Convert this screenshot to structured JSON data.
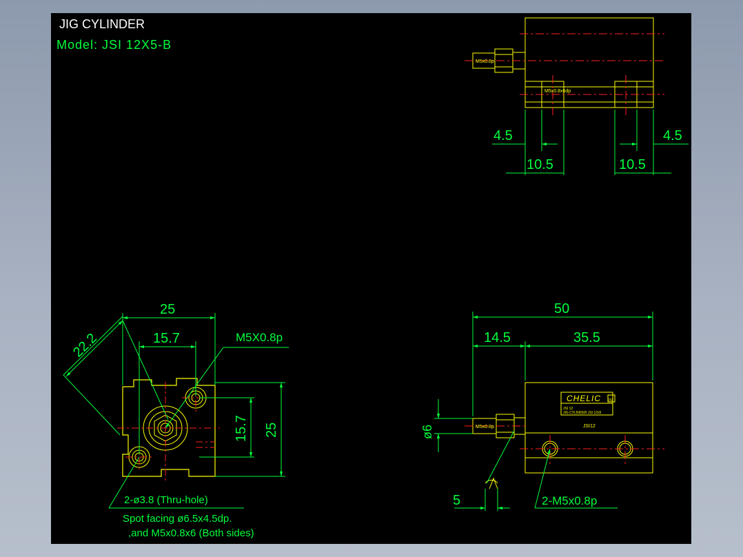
{
  "title": {
    "name": "JIG CYLINDER",
    "model": "Model:  JSI 12X5-B"
  },
  "top_view": {
    "port_label": "M5x0.8p",
    "bore_label": "M5x0.8x6dp",
    "dims": [
      "4.5",
      "4.5",
      "10.5",
      "10.5"
    ]
  },
  "end_view": {
    "dims": {
      "width": "25",
      "diag": "22.2",
      "inner": "15.7",
      "height_inner": "15.7",
      "height": "25"
    },
    "thread_label": "M5X0.8p",
    "note_line1": "2-ø3.8 (Thru-hole)",
    "note_line2": "Spot facing ø6.5x4.5dp.",
    "note_line3": ",and M5x0.8x6 (Both sides)"
  },
  "side_view": {
    "dims": {
      "total": "50",
      "left": "14.5",
      "right": "35.5",
      "rod_dia": "ø6",
      "nut": "5"
    },
    "brand": "CHELIC",
    "badge": "JSI",
    "plate_line1": "JSI 12",
    "plate_line2": "JIG CYLINDER JSI 12x5",
    "model_tag": "JSI12",
    "port_label": "M5x0.8p",
    "ports_label": "2-M5x0.8p"
  }
}
